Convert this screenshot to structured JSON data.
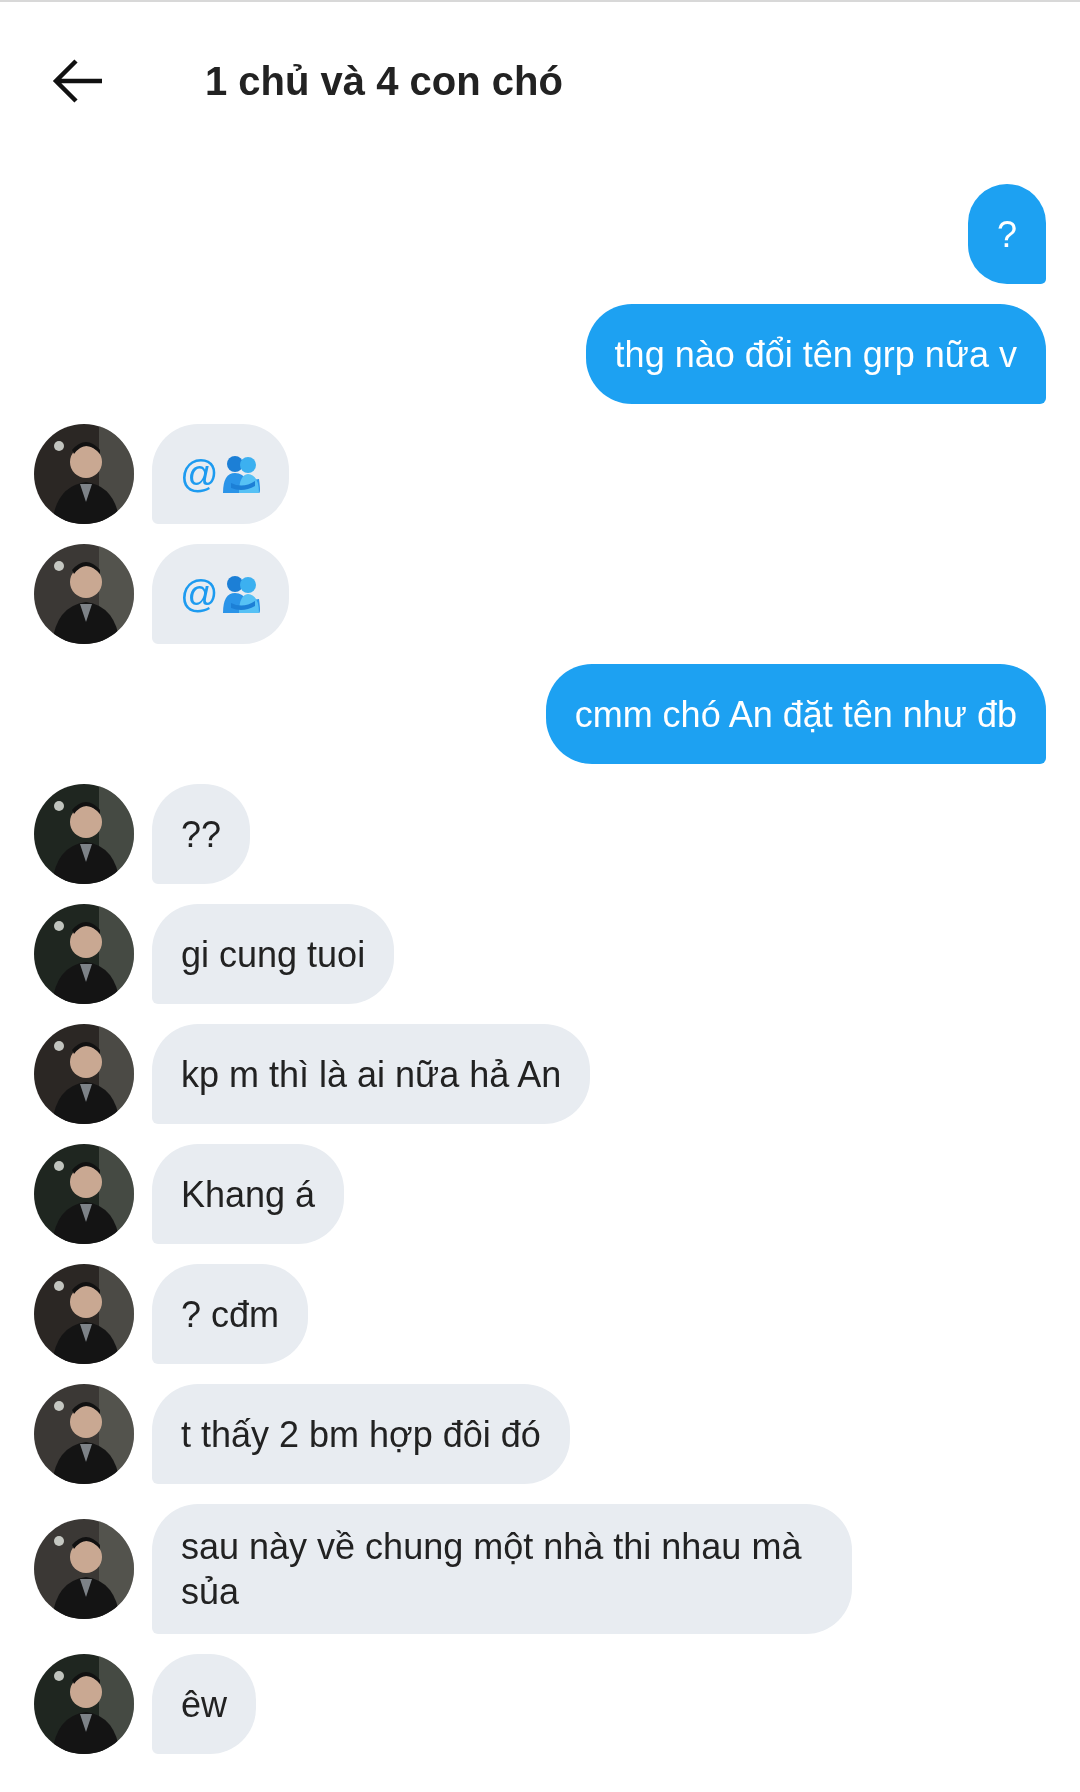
{
  "header": {
    "title": "1 chủ và 4 con chó"
  },
  "messages": [
    {
      "outgoing": true,
      "kind": "text",
      "text": "?"
    },
    {
      "outgoing": true,
      "kind": "text",
      "text": "thg nào đổi tên grp nữa v"
    },
    {
      "outgoing": false,
      "kind": "mention",
      "text": "@",
      "color": "#2b2724"
    },
    {
      "outgoing": false,
      "kind": "mention",
      "text": "@",
      "color": "#3b3835"
    },
    {
      "outgoing": true,
      "kind": "text",
      "text": "cmm chó An đặt tên như đb"
    },
    {
      "outgoing": false,
      "kind": "text",
      "text": "??",
      "color": "#1f2620"
    },
    {
      "outgoing": false,
      "kind": "text",
      "text": "gi cung tuoi",
      "color": "#1f2620"
    },
    {
      "outgoing": false,
      "kind": "text",
      "text": "kp m thì là ai nữa hả An",
      "color": "#2b2724"
    },
    {
      "outgoing": false,
      "kind": "text",
      "text": "Khang á",
      "color": "#1f2620"
    },
    {
      "outgoing": false,
      "kind": "text",
      "text": "? cđm",
      "color": "#2b2724"
    },
    {
      "outgoing": false,
      "kind": "text",
      "text": "t thấy 2 bm hợp đôi đó",
      "color": "#3b3835"
    },
    {
      "outgoing": false,
      "kind": "text",
      "text": "sau này về chung một nhà thi nhau mà sủa",
      "color": "#3b3835"
    },
    {
      "outgoing": false,
      "kind": "text",
      "text": "êw",
      "color": "#1f2620"
    }
  ]
}
